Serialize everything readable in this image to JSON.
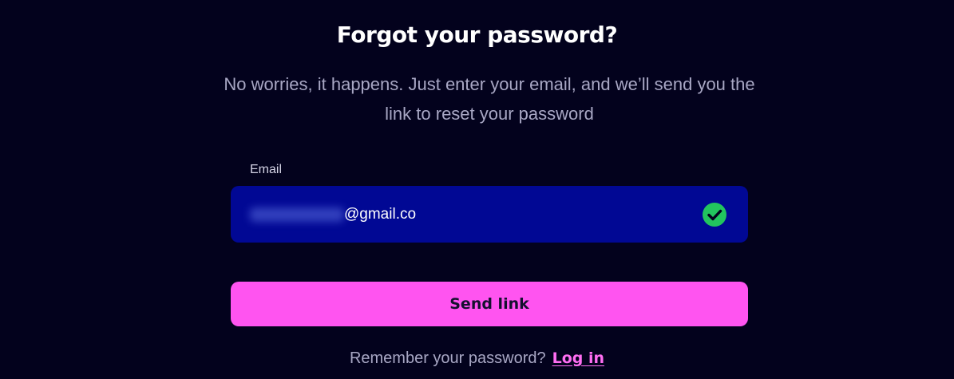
{
  "header": {
    "title": "Forgot your password?",
    "subtitle": "No worries, it happens. Just enter your email, and we’ll send you the link to reset your password"
  },
  "form": {
    "email_label": "Email",
    "email_value_visible": "@gmail.co",
    "email_status_icon": "check-circle-icon",
    "send_label": "Send link"
  },
  "footer": {
    "prompt": "Remember your password?",
    "login_label": "Log in"
  },
  "colors": {
    "background": "#03021d",
    "input_background": "#010894",
    "button_background": "#ff54f0",
    "link": "#ff6ef2",
    "success": "#22c55e"
  }
}
